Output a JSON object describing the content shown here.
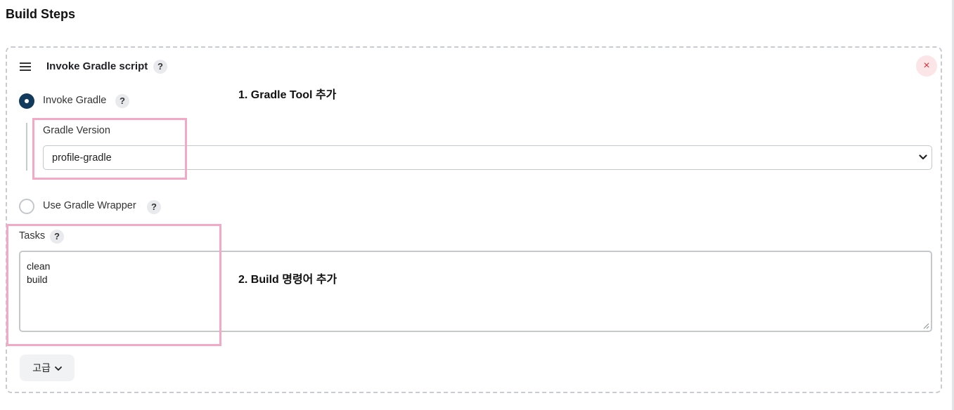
{
  "section": {
    "title": "Build Steps"
  },
  "step": {
    "title": "Invoke Gradle script",
    "help": "?",
    "close": "×",
    "options": {
      "invoke_gradle": {
        "label": "Invoke Gradle",
        "selected": true
      },
      "use_wrapper": {
        "label": "Use Gradle Wrapper",
        "selected": false
      }
    },
    "gradle_version": {
      "label": "Gradle Version",
      "value": "profile-gradle"
    },
    "tasks": {
      "label": "Tasks",
      "value": "clean\nbuild"
    },
    "advanced": {
      "label": "고급"
    }
  },
  "annotations": {
    "one": "1. Gradle Tool 추가",
    "two": "2. Build 명령어 추가",
    "highlight_color": "#f3a9c6"
  },
  "icons": {
    "drag": "drag-handle-icon",
    "help": "help-icon",
    "close": "close-icon",
    "select": "chevron-down-icon",
    "advanced": "chevron-down-icon"
  },
  "colors": {
    "radio_selected": "#113a5c",
    "close_bg": "#fbe5e7",
    "close_fg": "#e0303c",
    "border": "#c4c7cc"
  }
}
